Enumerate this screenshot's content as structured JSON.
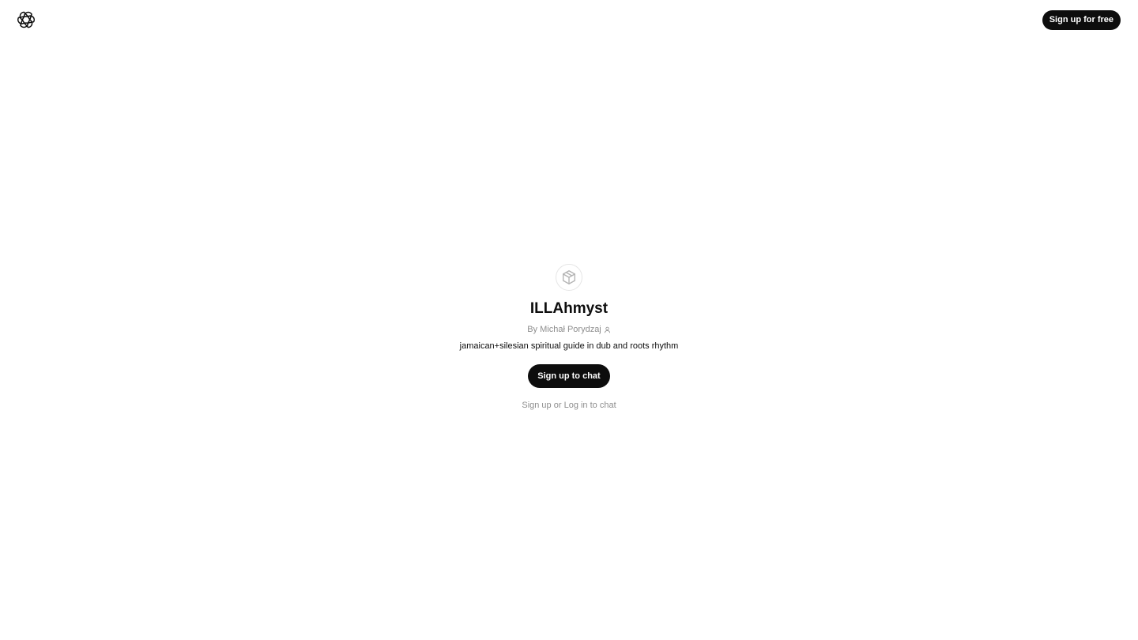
{
  "header": {
    "logo_icon": "openai-logo-icon",
    "signup_free_label": "Sign up for free"
  },
  "gpt": {
    "avatar_icon": "cube-icon",
    "name": "ILLAhmyst",
    "author": "By Michał Porydzaj",
    "author_icon": "person-icon",
    "description": "jamaican+silesian spiritual guide in dub and roots rhythm"
  },
  "actions": {
    "signup_chat_label": "Sign up to chat",
    "signup_link": "Sign up",
    "or_text": " or ",
    "login_link": "Log in",
    "to_chat_text": " to chat"
  },
  "colors": {
    "button_bg": "#0d0d0d",
    "muted_text": "#8e8e8e",
    "background": "#ffffff"
  }
}
